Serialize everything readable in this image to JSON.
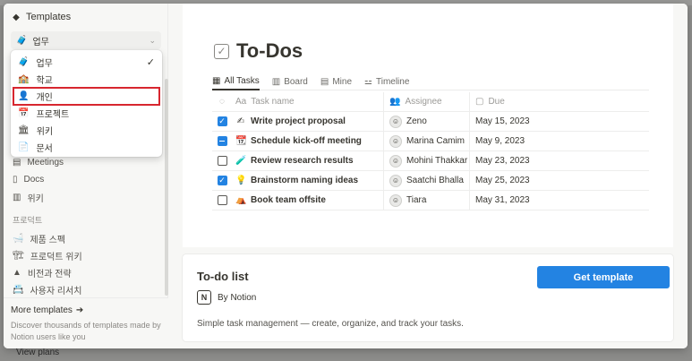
{
  "sidebar": {
    "header": "Templates",
    "selected_category": "업무",
    "dropdown": [
      {
        "label": "업무",
        "icon": "🧳",
        "checked": true
      },
      {
        "label": "학교",
        "icon": "🏫"
      },
      {
        "label": "개인",
        "icon": "👤",
        "highlighted": true
      },
      {
        "label": "프로젝트",
        "icon": "📅"
      },
      {
        "label": "위키",
        "icon": "🏛"
      },
      {
        "label": "문서",
        "icon": "📄"
      }
    ],
    "items": [
      {
        "label": "Meetings",
        "icon": "▤"
      },
      {
        "label": "Docs",
        "icon": "▯"
      },
      {
        "label": "위키",
        "icon": "▥"
      }
    ],
    "section": "프로덕트",
    "section_items": [
      {
        "label": "제품 스펙",
        "icon": "🛁"
      },
      {
        "label": "프로덕트 위키",
        "icon": "🏗"
      },
      {
        "label": "비전과 전략",
        "icon": "▲"
      },
      {
        "label": "사용자 리서치",
        "icon": "📇"
      }
    ],
    "footer": {
      "title": "More templates",
      "desc": "Discover thousands of templates made by Notion users like you"
    }
  },
  "background": {
    "view_plans": "View plans"
  },
  "preview": {
    "title": "To-Dos",
    "views": [
      {
        "label": "All Tasks",
        "icon": "▦",
        "active": true
      },
      {
        "label": "Board",
        "icon": "▥"
      },
      {
        "label": "Mine",
        "icon": "▤"
      },
      {
        "label": "Timeline",
        "icon": "⚍"
      }
    ],
    "columns": {
      "name": "Task name",
      "assignee": "Assignee",
      "due": "Due"
    },
    "rows": [
      {
        "state": "checked",
        "icon": "✍",
        "name": "Write project proposal",
        "assignee": "Zeno",
        "due": "May 15, 2023"
      },
      {
        "state": "partial",
        "icon": "📆",
        "name": "Schedule kick-off meeting",
        "assignee": "Marina Camim",
        "due": "May 9, 2023"
      },
      {
        "state": "unchecked",
        "icon": "🧪",
        "name": "Review research results",
        "assignee": "Mohini Thakkar",
        "due": "May 23, 2023"
      },
      {
        "state": "checked",
        "icon": "💡",
        "name": "Brainstorm naming ideas",
        "assignee": "Saatchi Bhalla",
        "due": "May 25, 2023"
      },
      {
        "state": "unchecked",
        "icon": "⛺",
        "name": "Book team offsite",
        "assignee": "Tiara",
        "due": "May 31, 2023"
      }
    ]
  },
  "card": {
    "title": "To-do list",
    "by": "By Notion",
    "logo": "N",
    "desc": "Simple task management — create, organize, and track your tasks.",
    "button": "Get template"
  },
  "colors": {
    "accent": "#2383e2",
    "highlight": "#d7262f"
  }
}
